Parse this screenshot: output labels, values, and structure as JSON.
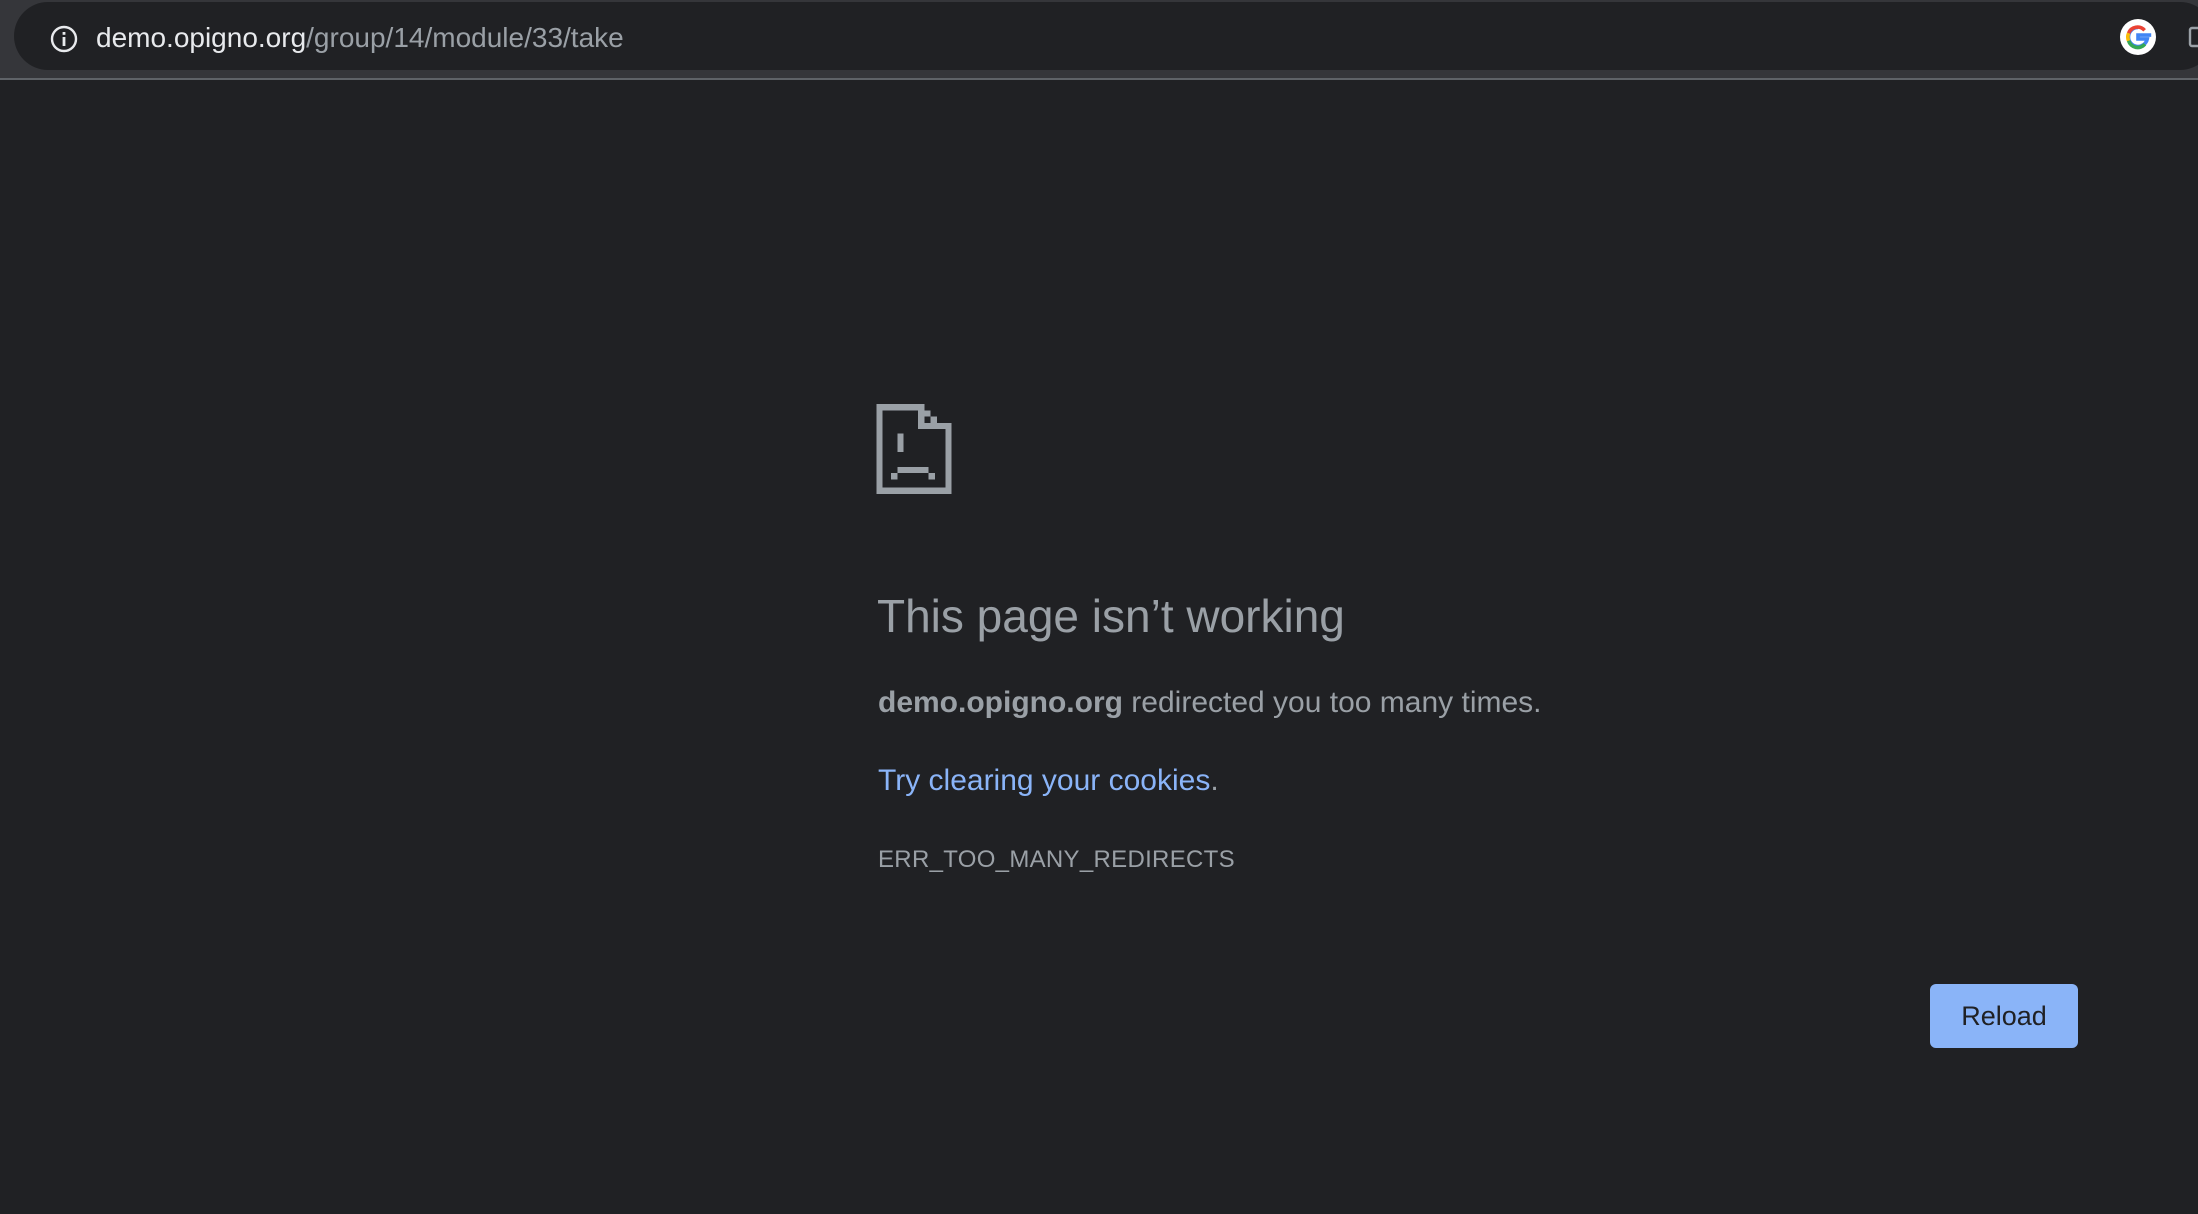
{
  "browser": {
    "url_host": "demo.opigno.org",
    "url_path": "/group/14/module/33/take",
    "icons": {
      "site_info": "info-icon",
      "search_engine": "google-icon",
      "extension": "extension-icon"
    }
  },
  "error_page": {
    "icon": "sad-page-icon",
    "heading": "This page isn’t working",
    "summary_host": "demo.opigno.org",
    "summary_text": " redirected you too many times.",
    "suggestion_link": "Try clearing your cookies",
    "suggestion_end": ".",
    "error_code": "ERR_TOO_MANY_REDIRECTS",
    "reload_label": "Reload"
  },
  "colors": {
    "background": "#202124",
    "toolbar": "#35363a",
    "text": "#9aa0a6",
    "link": "#8ab4f8",
    "button": "#8ab4f8"
  }
}
